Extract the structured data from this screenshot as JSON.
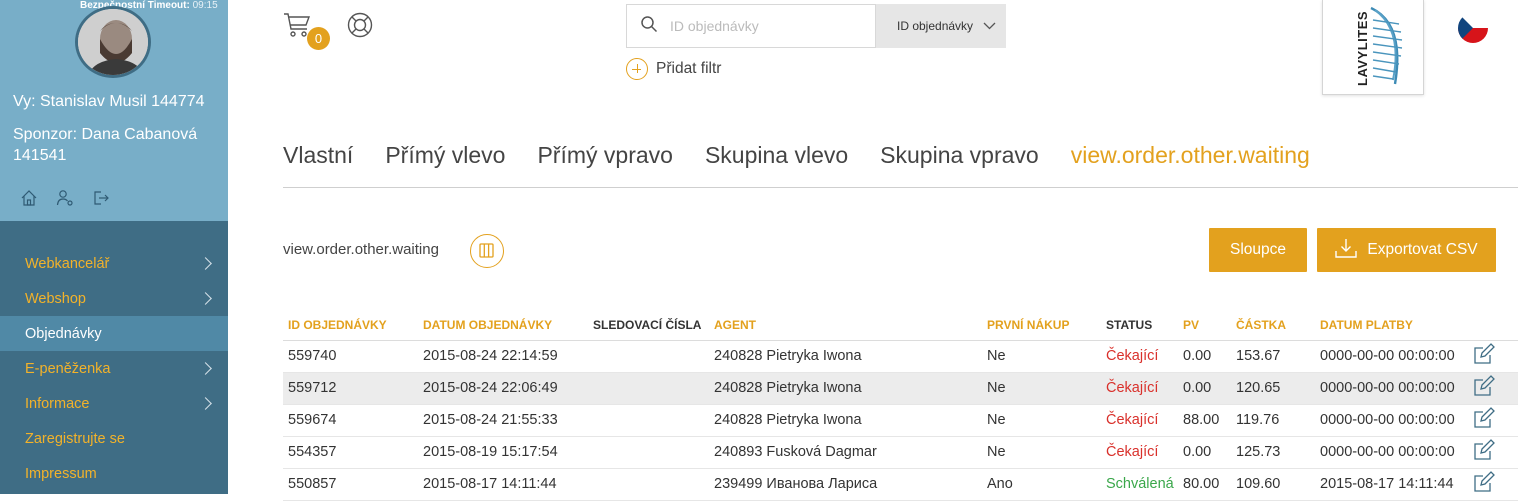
{
  "sidebar": {
    "timeout_label": "Bezpečnostní Timeout:",
    "timeout_value": "09:15",
    "user_line": "Vy: Stanislav Musil 144774",
    "sponsor_line": "Sponzor: Dana Cabanová 141541",
    "icons": [
      "home-icon",
      "user-settings-icon",
      "logout-icon"
    ],
    "nav": [
      {
        "label": "Webkancelář",
        "has_children": true,
        "active": false
      },
      {
        "label": "Webshop",
        "has_children": true,
        "active": false
      },
      {
        "label": "Objednávky",
        "has_children": false,
        "active": true
      },
      {
        "label": "E-peněženka",
        "has_children": true,
        "active": false
      },
      {
        "label": "Informace",
        "has_children": true,
        "active": false
      },
      {
        "label": "Zaregistrujte se",
        "has_children": false,
        "active": false
      },
      {
        "label": "Impressum",
        "has_children": false,
        "active": false
      }
    ]
  },
  "header": {
    "cart_count": "0",
    "search": {
      "placeholder": "ID objednávky",
      "value": "",
      "field_select": "ID objednávky"
    },
    "add_filter_label": "Přidat filtr",
    "logo_text": "LAVYLITES",
    "language": "cs"
  },
  "tabs": [
    {
      "label": "Vlastní",
      "active": false
    },
    {
      "label": "Přímý vlevo",
      "active": false
    },
    {
      "label": "Přímý vpravo",
      "active": false
    },
    {
      "label": "Skupina vlevo",
      "active": false
    },
    {
      "label": "Skupina vpravo",
      "active": false
    },
    {
      "label": "view.order.other.waiting",
      "active": true
    }
  ],
  "toolbar": {
    "section_title": "view.order.other.waiting",
    "columns_button": "Sloupce",
    "export_button": "Exportovat CSV"
  },
  "table": {
    "columns": [
      "ID OBJEDNÁVKY",
      "DATUM OBJEDNÁVKY",
      "SLEDOVACÍ ČÍSLA",
      "AGENT",
      "PRVNÍ NÁKUP",
      "STATUS",
      "PV",
      "ČÁSTKA",
      "DATUM PLATBY"
    ],
    "rows": [
      {
        "id": "559740",
        "date": "2015-08-24 22:14:59",
        "tracking": "",
        "agent": "240828 Pietryka Iwona",
        "first": "Ne",
        "status": "Čekající",
        "status_kind": "waiting",
        "pv": "0.00",
        "amount": "153.67",
        "paid": "0000-00-00 00:00:00"
      },
      {
        "id": "559712",
        "date": "2015-08-24 22:06:49",
        "tracking": "",
        "agent": "240828 Pietryka Iwona",
        "first": "Ne",
        "status": "Čekající",
        "status_kind": "waiting",
        "pv": "0.00",
        "amount": "120.65",
        "paid": "0000-00-00 00:00:00"
      },
      {
        "id": "559674",
        "date": "2015-08-24 21:55:33",
        "tracking": "",
        "agent": "240828 Pietryka Iwona",
        "first": "Ne",
        "status": "Čekající",
        "status_kind": "waiting",
        "pv": "88.00",
        "amount": "119.76",
        "paid": "0000-00-00 00:00:00"
      },
      {
        "id": "554357",
        "date": "2015-08-19 15:17:54",
        "tracking": "",
        "agent": "240893 Fusková Dagmar",
        "first": "Ne",
        "status": "Čekající",
        "status_kind": "waiting",
        "pv": "0.00",
        "amount": "125.73",
        "paid": "0000-00-00 00:00:00"
      },
      {
        "id": "550857",
        "date": "2015-08-17 14:11:44",
        "tracking": "",
        "agent": "239499 Иванова Лариса",
        "first": "Ano",
        "status": "Schválená",
        "status_kind": "approved",
        "pv": "80.00",
        "amount": "109.60",
        "paid": "2015-08-17 14:11:44"
      }
    ]
  },
  "colors": {
    "accent": "#e3a11e",
    "sidebar_top": "#78aec8",
    "sidebar_nav": "#3f6d85",
    "sidebar_active": "#5089a6",
    "status_waiting": "#d9302b",
    "status_approved": "#3aa74a"
  }
}
